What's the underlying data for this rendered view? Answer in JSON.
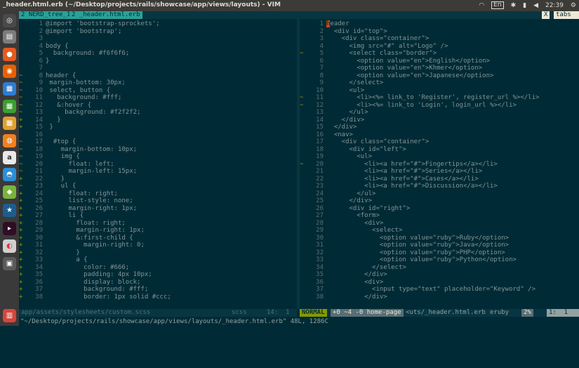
{
  "window": {
    "title": "_header.html.erb (~/Desktop/projects/rails/showcase/app/views/layouts) - VIM"
  },
  "tray": {
    "lang": "En",
    "time": "22:39"
  },
  "tabline": {
    "tab1": "2 NERD_tree_1",
    "tab2": "2 _header.html.erb",
    "close": "X",
    "tabs": "tabs"
  },
  "left": {
    "lines": [
      {
        "n": "1",
        "s": "",
        "c": "@import 'bootstrap-sprockets';",
        "cls": "s"
      },
      {
        "n": "2",
        "s": "",
        "c": "@import 'bootstrap';",
        "cls": "s"
      },
      {
        "n": "3",
        "s": "",
        "c": "",
        "cls": "a"
      },
      {
        "n": "4",
        "s": "",
        "c": "body {",
        "cls": "t"
      },
      {
        "n": "5",
        "s": "",
        "c": "  background: #f6f6f6;",
        "cls": "k"
      },
      {
        "n": "6",
        "s": "",
        "c": "}",
        "cls": "t"
      },
      {
        "n": "7",
        "s": "",
        "c": "",
        "cls": "a"
      },
      {
        "n": "8",
        "s": "~",
        "c": "header {",
        "cls": "t"
      },
      {
        "n": "9",
        "s": "~",
        "c": " margin-bottom: 30px;",
        "cls": "k"
      },
      {
        "n": "10",
        "s": "~",
        "c": " select, button {",
        "cls": "t"
      },
      {
        "n": "11",
        "s": "~",
        "c": "   background: #fff;",
        "cls": "k"
      },
      {
        "n": "12",
        "s": "~",
        "c": "   &:hover {",
        "cls": "t"
      },
      {
        "n": "13",
        "s": "~",
        "c": "     background: #f2f2f2;",
        "cls": "k"
      },
      {
        "n": "14",
        "s": "+",
        "c": "   }",
        "cls": "t"
      },
      {
        "n": "15",
        "s": "+",
        "c": " }",
        "cls": "t"
      },
      {
        "n": "16",
        "s": "",
        "c": "",
        "cls": "a"
      },
      {
        "n": "17",
        "s": "~",
        "c": "  #top {",
        "cls": "t"
      },
      {
        "n": "18",
        "s": "~",
        "c": "    margin-bottom: 10px;",
        "cls": "k"
      },
      {
        "n": "19",
        "s": "~",
        "c": "    img {",
        "cls": "t"
      },
      {
        "n": "20",
        "s": "~",
        "c": "      float: left;",
        "cls": "k"
      },
      {
        "n": "21",
        "s": "~",
        "c": "      margin-left: 15px;",
        "cls": "k"
      },
      {
        "n": "22",
        "s": "+",
        "c": "    }",
        "cls": "t"
      },
      {
        "n": "23",
        "s": "~",
        "c": "    ul {",
        "cls": "t"
      },
      {
        "n": "24",
        "s": "+",
        "c": "      float: right;",
        "cls": "k"
      },
      {
        "n": "25",
        "s": "+",
        "c": "      list-style: none;",
        "cls": "k"
      },
      {
        "n": "26",
        "s": "+",
        "c": "      margin-right: 1px;",
        "cls": "k"
      },
      {
        "n": "27",
        "s": "+",
        "c": "      li {",
        "cls": "t"
      },
      {
        "n": "28",
        "s": "+",
        "c": "        float: right;",
        "cls": "k"
      },
      {
        "n": "29",
        "s": "+",
        "c": "        margin-right: 1px;",
        "cls": "k"
      },
      {
        "n": "30",
        "s": "+",
        "c": "        &:first-child {",
        "cls": "t"
      },
      {
        "n": "31",
        "s": "+",
        "c": "          margin-right: 0;",
        "cls": "k"
      },
      {
        "n": "32",
        "s": "+",
        "c": "        }",
        "cls": "t"
      },
      {
        "n": "33",
        "s": "+",
        "c": "        a {",
        "cls": "t"
      },
      {
        "n": "34",
        "s": "+",
        "c": "          color: #666;",
        "cls": "k"
      },
      {
        "n": "35",
        "s": "+",
        "c": "          padding: 4px 10px;",
        "cls": "k"
      },
      {
        "n": "36",
        "s": "+",
        "c": "          display: block;",
        "cls": "k"
      },
      {
        "n": "37",
        "s": "+",
        "c": "          background: #fff;",
        "cls": "k"
      },
      {
        "n": "38",
        "s": "+",
        "c": "          border: 1px solid #ccc;",
        "cls": "k"
      }
    ],
    "status": {
      "file": "app/assets/stylesheets/custom.scss",
      "ft": "scss",
      "pos": "14:  1"
    }
  },
  "right": {
    "lines": [
      {
        "n": "1",
        "s": "",
        "c": "header",
        "cls": "t"
      },
      {
        "n": "2",
        "s": "",
        "c": "  <div id=\"top\">",
        "cls": "t"
      },
      {
        "n": "3",
        "s": "",
        "c": "    <div class=\"container\">",
        "cls": "t"
      },
      {
        "n": "4",
        "s": "",
        "c": "      <img src=\"#\" alt=\"Logo\" />",
        "cls": "t"
      },
      {
        "n": "5",
        "s": "~",
        "c": "      <select class=\"border\">",
        "cls": "t"
      },
      {
        "n": "6",
        "s": "",
        "c": "        <option value=\"en\">English</option>",
        "cls": "t"
      },
      {
        "n": "7",
        "s": "",
        "c": "        <option value=\"en\">Khmer</option>",
        "cls": "t"
      },
      {
        "n": "8",
        "s": "",
        "c": "        <option value=\"en\">Japanese</option>",
        "cls": "t"
      },
      {
        "n": "9",
        "s": "",
        "c": "      </select>",
        "cls": "t"
      },
      {
        "n": "10",
        "s": "",
        "c": "      <ul>",
        "cls": "t"
      },
      {
        "n": "11",
        "s": "~",
        "c": "        <li><%= link_to 'Register', register_url %></li>",
        "cls": "t"
      },
      {
        "n": "12",
        "s": "~",
        "c": "        <li><%= link_to 'Login', login_url %></li>",
        "cls": "t"
      },
      {
        "n": "13",
        "s": "",
        "c": "      </ul>",
        "cls": "t"
      },
      {
        "n": "14",
        "s": "",
        "c": "    </div>",
        "cls": "t"
      },
      {
        "n": "15",
        "s": "",
        "c": "  </div>",
        "cls": "t"
      },
      {
        "n": "16",
        "s": "",
        "c": "  <nav>",
        "cls": "t"
      },
      {
        "n": "17",
        "s": "",
        "c": "    <div class=\"container\">",
        "cls": "t"
      },
      {
        "n": "18",
        "s": "",
        "c": "      <div id=\"left\">",
        "cls": "t"
      },
      {
        "n": "19",
        "s": "",
        "c": "        <ul>",
        "cls": "t"
      },
      {
        "n": "20",
        "s": "~",
        "c": "          <li><a href=\"#\">Fingertips</a></li>",
        "cls": "t"
      },
      {
        "n": "21",
        "s": "",
        "c": "          <li><a href=\"#\">Series</a></li>",
        "cls": "t"
      },
      {
        "n": "22",
        "s": "",
        "c": "          <li><a href=\"#\">Cases</a></li>",
        "cls": "t"
      },
      {
        "n": "23",
        "s": "",
        "c": "          <li><a href=\"#\">Discussion</a></li>",
        "cls": "t"
      },
      {
        "n": "24",
        "s": "",
        "c": "        </ul>",
        "cls": "t"
      },
      {
        "n": "25",
        "s": "",
        "c": "      </div>",
        "cls": "t"
      },
      {
        "n": "26",
        "s": "",
        "c": "      <div id=\"right\">",
        "cls": "t"
      },
      {
        "n": "27",
        "s": "",
        "c": "        <form>",
        "cls": "t"
      },
      {
        "n": "28",
        "s": "",
        "c": "          <div>",
        "cls": "t"
      },
      {
        "n": "29",
        "s": "",
        "c": "            <select>",
        "cls": "t"
      },
      {
        "n": "30",
        "s": "",
        "c": "              <option value=\"ruby\">Ruby</option>",
        "cls": "t"
      },
      {
        "n": "31",
        "s": "",
        "c": "              <option value=\"ruby\">Java</option>",
        "cls": "t"
      },
      {
        "n": "32",
        "s": "",
        "c": "              <option value=\"ruby\">PHP</option>",
        "cls": "t"
      },
      {
        "n": "33",
        "s": "",
        "c": "              <option value=\"ruby\">Python</option>",
        "cls": "t"
      },
      {
        "n": "34",
        "s": "",
        "c": "            </select>",
        "cls": "t"
      },
      {
        "n": "35",
        "s": "",
        "c": "          </div>",
        "cls": "t"
      },
      {
        "n": "36",
        "s": "",
        "c": "          <div>",
        "cls": "t"
      },
      {
        "n": "37",
        "s": "",
        "c": "            <input type=\"text\" placeholder=\"Keyword\" />",
        "cls": "t"
      },
      {
        "n": "38",
        "s": "",
        "c": "          </div>",
        "cls": "t"
      }
    ],
    "status": {
      "mode": "NORMAL",
      "git": "+0 ~4 -0 home-page",
      "file": "<uts/_header.html.erb",
      "ft": "eruby",
      "pct": "2%",
      "pos": "1:  1"
    }
  },
  "cmdline": "\"~/Desktop/projects/rails/showcase/app/views/layouts/_header.html.erb\" 48L, 1286C",
  "colors": {
    "bg": "#002b36",
    "tag": "#268bd2",
    "prop": "#cb4b16",
    "str": "#2aa198",
    "add": "#859900",
    "mod": "#b58900"
  }
}
